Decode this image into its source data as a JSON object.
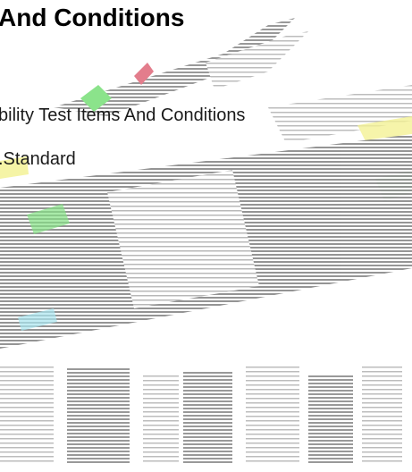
{
  "document": {
    "heading": "And Conditions",
    "lines": [
      "bility Test Items And Conditions",
      ".Standard"
    ]
  },
  "colors": {
    "text": "#000000",
    "stripe_gray": "#8a8a8a",
    "accent_green": "#7fe07f",
    "accent_yellow": "#f3f08a",
    "accent_pink": "#e07080"
  }
}
